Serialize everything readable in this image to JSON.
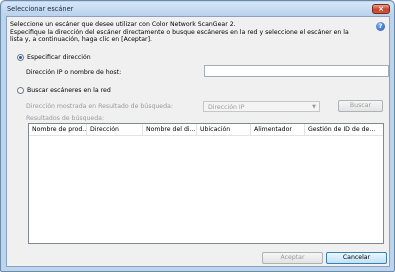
{
  "window": {
    "title": "Seleccionar escáner",
    "close_label": "×"
  },
  "intro": {
    "line1": "Seleccione un escáner que desee utilizar con Color Network ScanGear 2.",
    "line2": "Especifique la dirección del escáner directamente o busque escáneres en la red y seleccione el escáner en la",
    "line3": "lista y, a continuación, haga clic en [Aceptar]."
  },
  "help_icon_label": "?",
  "specify": {
    "label": "Especificar dirección",
    "selected": true,
    "ip_label": "Dirección IP o nombre de host:",
    "ip_value": ""
  },
  "search": {
    "label": "Buscar escáneres en la red",
    "selected": false,
    "address_label": "Dirección mostrada en Resultado de búsqueda:",
    "address_value": "Dirección IP",
    "search_button": "Buscar",
    "results_label": "Resultados de búsqueda:",
    "columns": [
      "Nombre de prod...",
      "Dirección",
      "Nombre del di...",
      "Ubicación",
      "Alimentador",
      "Gestión de ID de de..."
    ]
  },
  "buttons": {
    "accept": "Aceptar",
    "cancel": "Cancelar"
  }
}
